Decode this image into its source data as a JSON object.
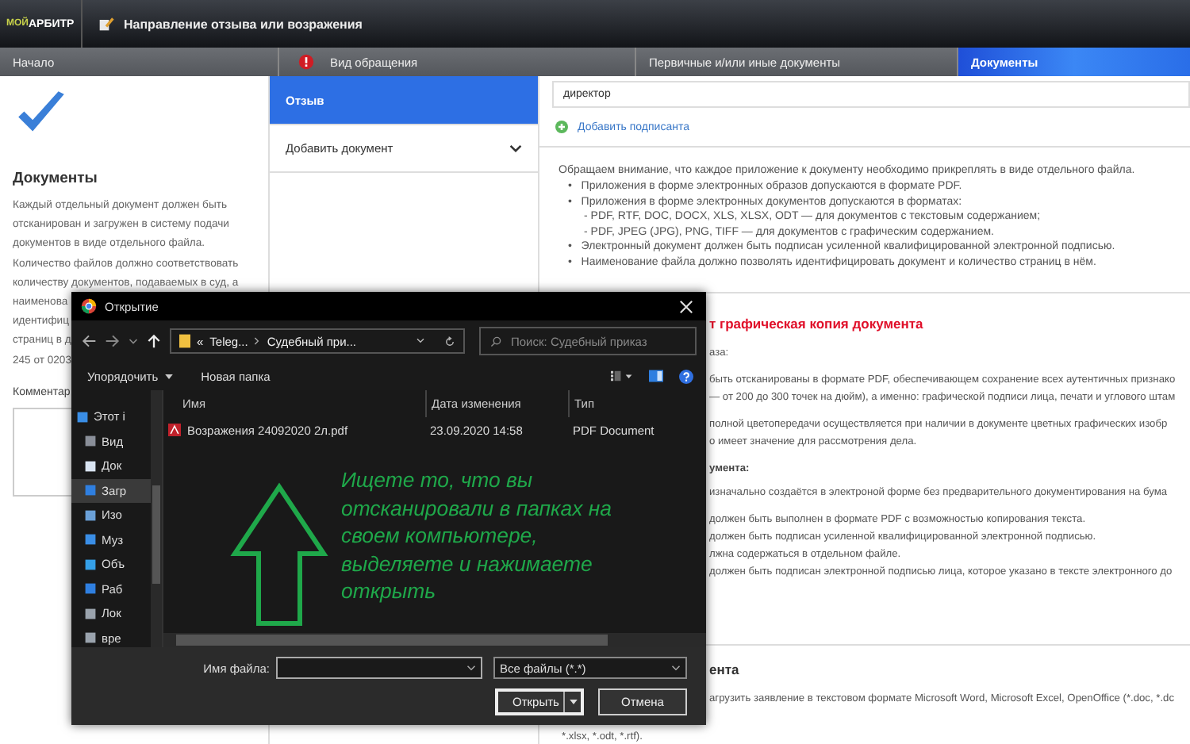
{
  "header": {
    "logo_prefix": "МОЙ",
    "logo_name": "АРБИТР",
    "title": "Направление отзыва или возражения"
  },
  "steps": [
    {
      "label": "Начало",
      "selected": false,
      "alert": false
    },
    {
      "label": "Вид обращения",
      "selected": false,
      "alert": true
    },
    {
      "label": "Первичные и/или иные документы",
      "selected": false,
      "alert": false
    },
    {
      "label": "Документы",
      "selected": true,
      "alert": false
    }
  ],
  "left": {
    "heading": "Документы",
    "paragraph_lines": [
      "Каждый отдельный документ должен быть",
      "отсканирован и загружен в систему подачи",
      "документов в виде отдельного файла.",
      "Количество файлов должно соответствовать",
      "количеству документов, подаваемых в суд, а",
      "наименова",
      "идентифиц",
      "страниц в д",
      "245 от 0203"
    ],
    "comment_label": "Комментар"
  },
  "menu": [
    {
      "label": "Отзыв",
      "selected": true,
      "kind": "item"
    },
    {
      "label": "Добавить документ",
      "selected": false,
      "kind": "expander"
    }
  ],
  "signer": {
    "value": "директор",
    "add_link": "Добавить подписанта"
  },
  "notice": {
    "intro": "Обращаем внимание, что каждое приложение к документу необходимо прикреплять в виде отдельного файла.",
    "bullets": [
      {
        "marker": "•",
        "text": "Приложения в форме электронных образов допускаются в формате PDF."
      },
      {
        "marker": "•",
        "text": "Приложения в форме электронных документов допускаются в форматах:",
        "sublines": [
          "- PDF, RTF, DOC, DOCX, XLS, XLSX, ODT — для документов с текстовым содержанием;",
          "- PDF, JPEG (JPG), PNG, TIFF — для документов с графическим содержанием."
        ]
      },
      {
        "marker": "•",
        "text": "Электронный документ должен быть подписан усиленной квалифицированной электронной подписью."
      },
      {
        "marker": "•",
        "text": "Наименование файла должно позволять идентифицировать документ и количество страниц в нём."
      }
    ]
  },
  "copy_section": {
    "heading": "т графическая копия документа",
    "blocks": [
      {
        "kind": "text",
        "lines": [
          "аза:"
        ]
      },
      {
        "kind": "text",
        "lines": [
          "быть отсканированы в формате PDF, обеспечивающем сохранение всех аутентичных признако",
          "— от 200 до 300 точек на дюйм), а именно: графической подписи лица, печати и углового штам"
        ]
      },
      {
        "kind": "text",
        "lines": [
          "полной цветопередачи осуществляется при наличии в документе цветных графических изобр",
          "о имеет значение для рассмотрения дела."
        ]
      },
      {
        "kind": "label",
        "lines": [
          "умента:"
        ]
      },
      {
        "kind": "text",
        "lines": [
          "изначально создаётся в электроной форме без предварительного документирования на бума"
        ]
      },
      {
        "kind": "text",
        "lines": [
          "должен быть выполнен в формате PDF с возможностью копирования текста.",
          "должен быть подписан усиленной квалифицированной электронной подписью.",
          "лжна содержаться в отдельном файле.",
          "должен быть подписан электронной подписью лица, которое указано в тексте электронного до"
        ]
      }
    ]
  },
  "last_section": {
    "heading": "ента",
    "line": "агрузить заявление в текстовом формате Microsoft Word, Microsoft Excel, OpenOffice (*.doc, *.dc",
    "tail": "*.xlsx, *.odt, *.rtf)."
  },
  "dialog": {
    "title": "Открытие",
    "path_overflow": "«",
    "path": [
      "Teleg...",
      "Судебный при..."
    ],
    "search_placeholder": "Поиск: Судебный приказ",
    "organize": "Упорядочить",
    "new_folder": "Новая папка",
    "nav": [
      {
        "label": "Этот і",
        "selected": false
      },
      {
        "label": "Вид",
        "selected": false
      },
      {
        "label": "Док",
        "selected": false
      },
      {
        "label": "Загр",
        "selected": true
      },
      {
        "label": "Изо",
        "selected": false
      },
      {
        "label": "Муз",
        "selected": false
      },
      {
        "label": "Объ",
        "selected": false
      },
      {
        "label": "Раб",
        "selected": false
      },
      {
        "label": "Лок",
        "selected": false
      },
      {
        "label": "вре",
        "selected": false
      }
    ],
    "columns": [
      "Имя",
      "Дата изменения",
      "Тип"
    ],
    "files": [
      {
        "name": "Возражения 24092020 2л.pdf",
        "modified": "23.09.2020 14:58",
        "type": "PDF Document"
      }
    ],
    "annotation": "Ищете то, что вы\nотсканировали в папках на\nсвоем компьютере,\nвыделяете и нажимаете\nоткрыть",
    "filename_label": "Имя файла:",
    "filter": "Все файлы (*.*)",
    "open_button": "Открыть",
    "cancel_button": "Отмена"
  }
}
